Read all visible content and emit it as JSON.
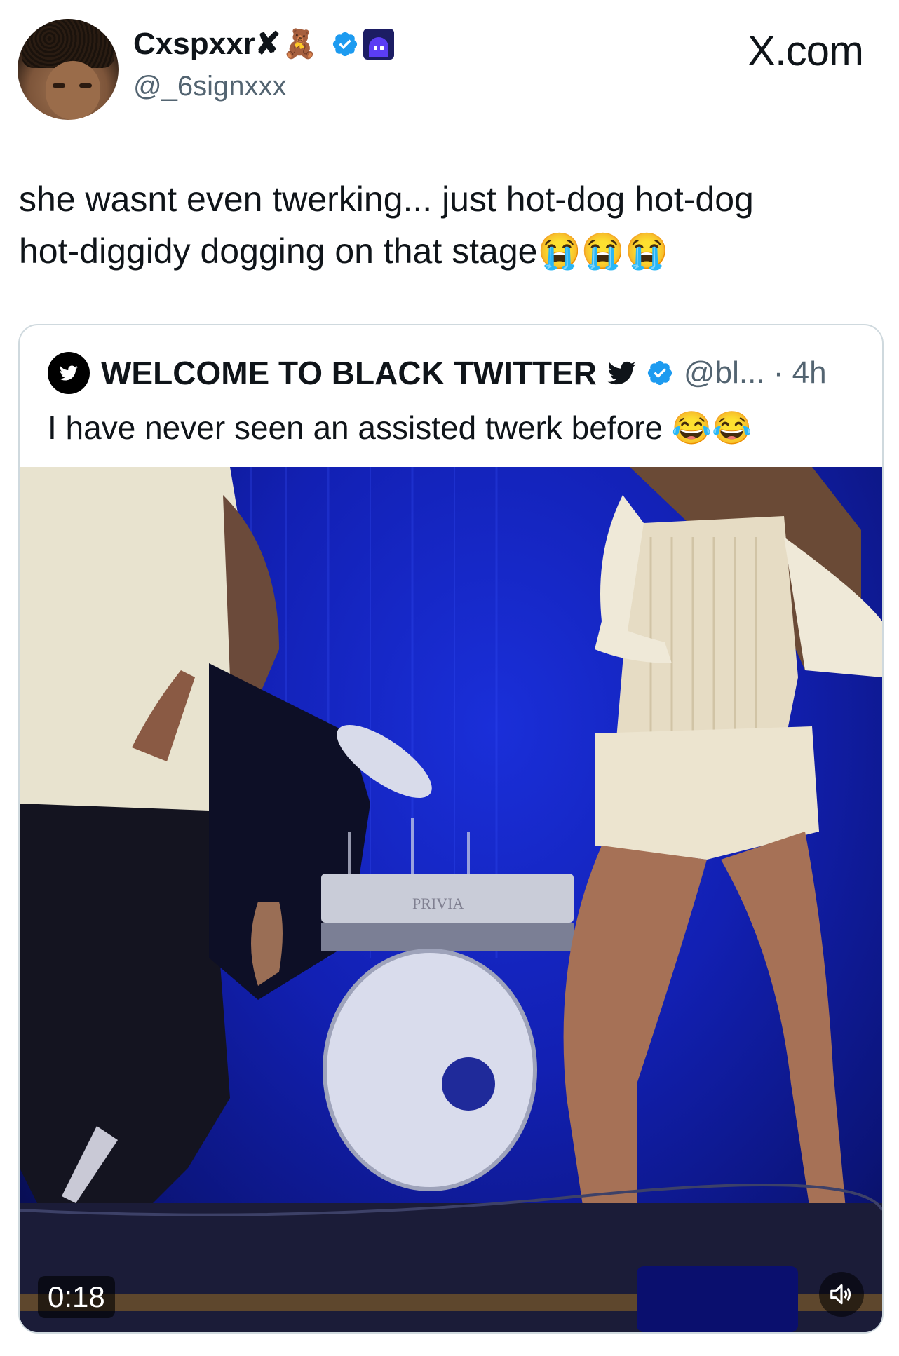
{
  "header": {
    "display_name": "Cxspxxr",
    "name_cross": "✘",
    "name_emoji": "🧸",
    "handle": "@_6signxxx",
    "source_label": "X.com"
  },
  "tweet": {
    "text": "she wasnt even twerking... just hot-dog hot-dog\nhot-diggidy dogging on that stage😭😭😭"
  },
  "quote": {
    "name": "WELCOME TO BLACK TWITTER",
    "handle_time": "@bl... · 4h",
    "text": "I have never seen an assisted twerk before 😂😂"
  },
  "video": {
    "duration": "0:18",
    "keyboard_label": "PRIVIA"
  },
  "colors": {
    "verified_blue": "#1d9bf0",
    "text_primary": "#0f1419",
    "text_secondary": "#536471",
    "card_border": "#cfd9de",
    "stage_blue": "#1220b3"
  },
  "icons": {
    "verified": "verified-badge-icon",
    "app_badge": "ghost-app-icon",
    "bird": "twitter-bird-icon",
    "mute": "speaker-icon"
  }
}
